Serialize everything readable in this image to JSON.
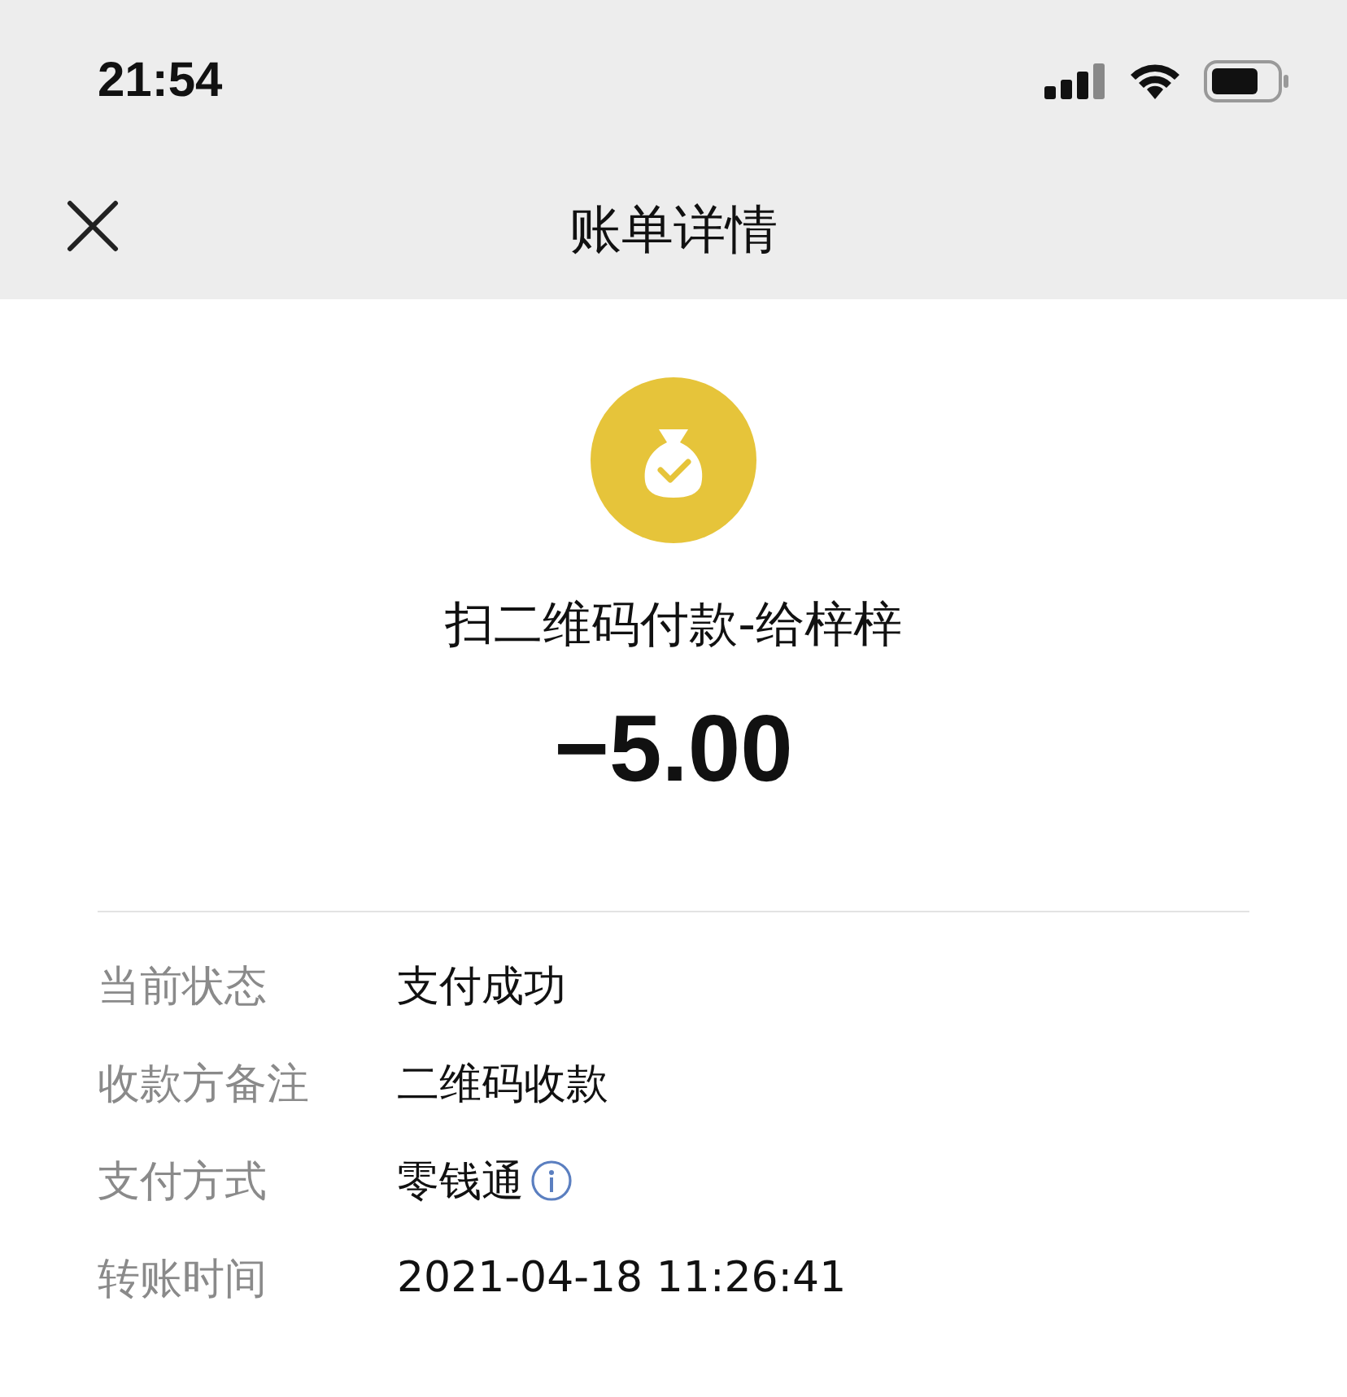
{
  "status_bar": {
    "time": "21:54"
  },
  "nav": {
    "title": "账单详情"
  },
  "payment": {
    "title": "扫二维码付款-给梓梓",
    "amount": "−5.00"
  },
  "details": [
    {
      "label": "当前状态",
      "value": "支付成功",
      "kind": "plain"
    },
    {
      "label": "收款方备注",
      "value": "二维码收款",
      "kind": "plain"
    },
    {
      "label": "支付方式",
      "value": "零钱通",
      "kind": "info"
    },
    {
      "label": "转账时间",
      "value": "2021-04-18 11:26:41",
      "kind": "plain"
    }
  ]
}
